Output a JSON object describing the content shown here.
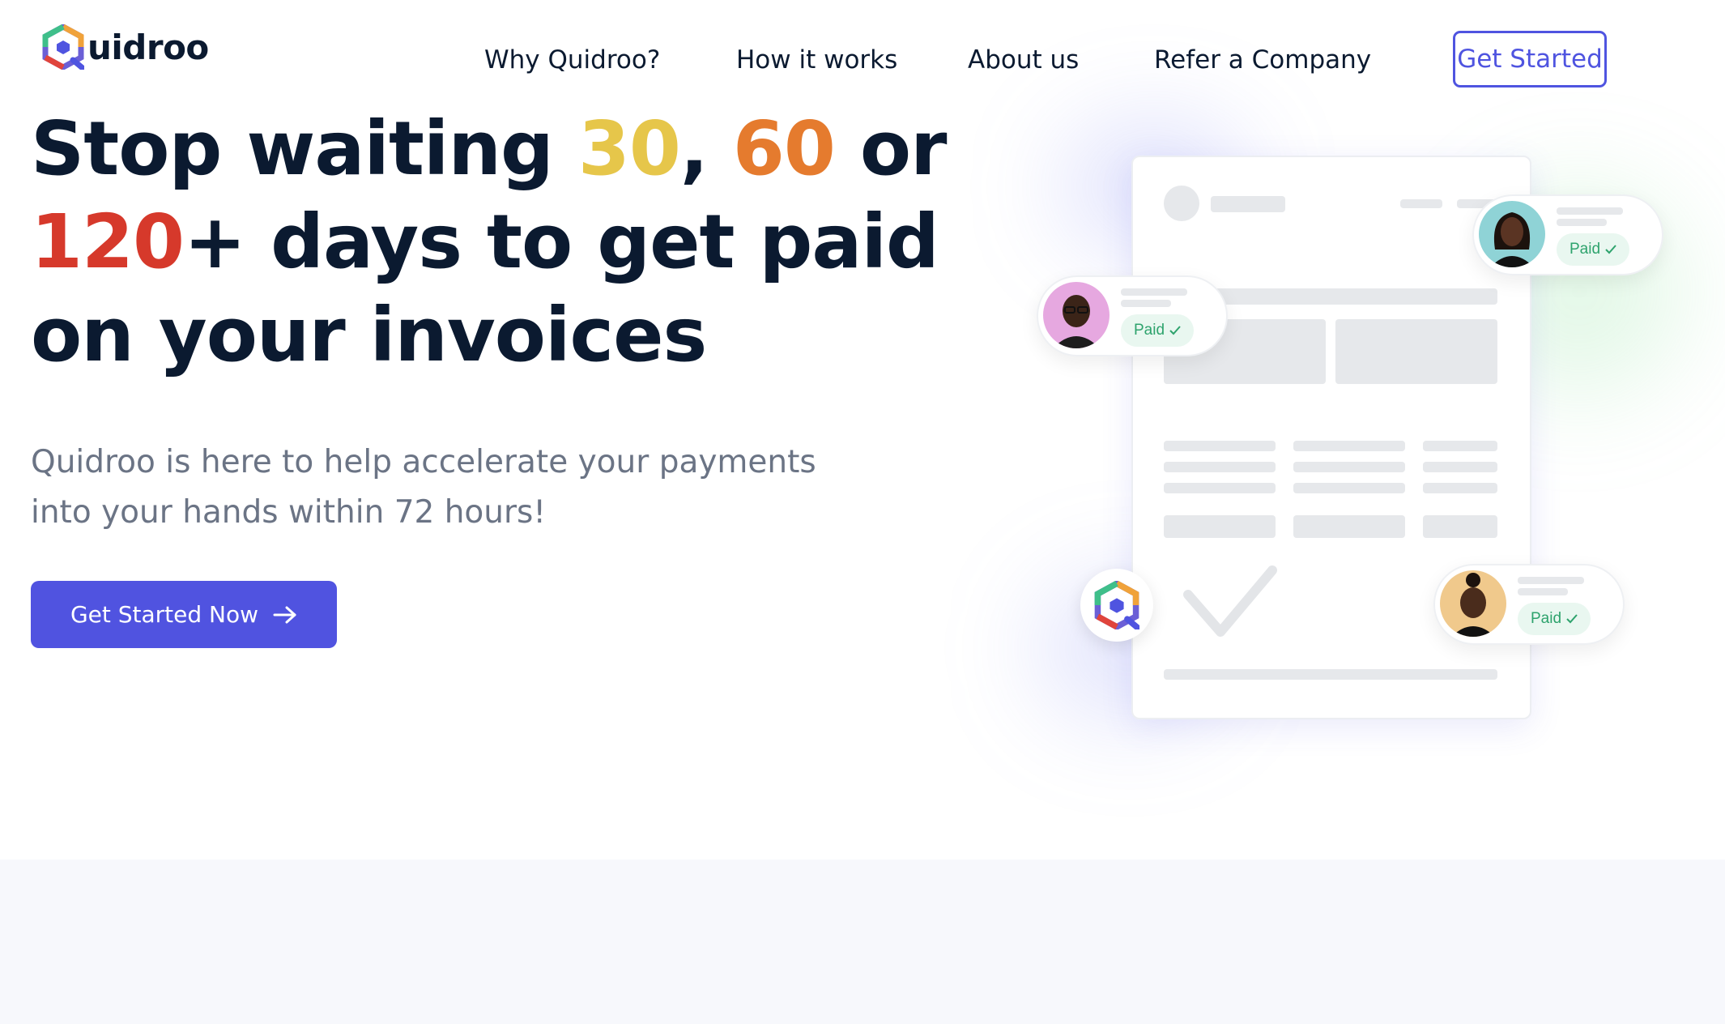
{
  "brand": {
    "name": "uidroo"
  },
  "nav": {
    "items": [
      {
        "label": "Why Quidroo?"
      },
      {
        "label": "How it works"
      },
      {
        "label": "About us"
      },
      {
        "label": "Refer a Company"
      }
    ],
    "cta_label": "Get Started"
  },
  "hero": {
    "title_part1": "Stop waiting ",
    "title_30": "30",
    "title_comma": ", ",
    "title_60": "60",
    "title_or": " or",
    "title_120": "120",
    "title_part2": "+ days to get paid",
    "title_part3": "on your invoices",
    "subtitle_line1": "Quidroo is here to help accelerate your payments",
    "subtitle_line2": "into your hands within 72 hours!",
    "cta_label": "Get Started Now",
    "cta_icon": "arrow-right-icon"
  },
  "illustration": {
    "paid_label": "Paid",
    "check_icon": "check-icon"
  },
  "colors": {
    "accent": "#5053e0",
    "navy": "#0b1a30",
    "yellow": "#e6c64a",
    "orange": "#e57b2e",
    "red": "#d6392b",
    "paid_green": "#2ea36d"
  }
}
